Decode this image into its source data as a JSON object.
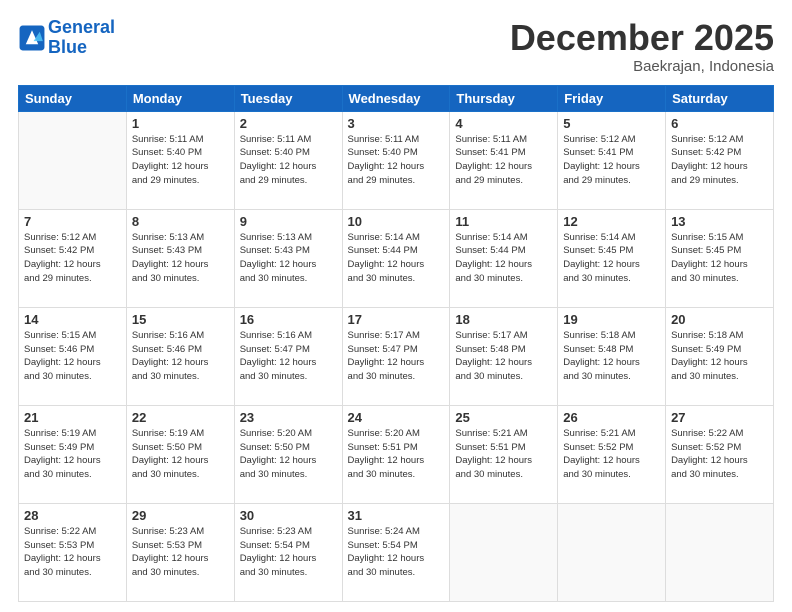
{
  "header": {
    "logo_line1": "General",
    "logo_line2": "Blue",
    "month": "December 2025",
    "location": "Baekrajan, Indonesia"
  },
  "weekdays": [
    "Sunday",
    "Monday",
    "Tuesday",
    "Wednesday",
    "Thursday",
    "Friday",
    "Saturday"
  ],
  "rows": [
    [
      {
        "day": "",
        "info": ""
      },
      {
        "day": "1",
        "info": "Sunrise: 5:11 AM\nSunset: 5:40 PM\nDaylight: 12 hours\nand 29 minutes."
      },
      {
        "day": "2",
        "info": "Sunrise: 5:11 AM\nSunset: 5:40 PM\nDaylight: 12 hours\nand 29 minutes."
      },
      {
        "day": "3",
        "info": "Sunrise: 5:11 AM\nSunset: 5:40 PM\nDaylight: 12 hours\nand 29 minutes."
      },
      {
        "day": "4",
        "info": "Sunrise: 5:11 AM\nSunset: 5:41 PM\nDaylight: 12 hours\nand 29 minutes."
      },
      {
        "day": "5",
        "info": "Sunrise: 5:12 AM\nSunset: 5:41 PM\nDaylight: 12 hours\nand 29 minutes."
      },
      {
        "day": "6",
        "info": "Sunrise: 5:12 AM\nSunset: 5:42 PM\nDaylight: 12 hours\nand 29 minutes."
      }
    ],
    [
      {
        "day": "7",
        "info": "Sunrise: 5:12 AM\nSunset: 5:42 PM\nDaylight: 12 hours\nand 29 minutes."
      },
      {
        "day": "8",
        "info": "Sunrise: 5:13 AM\nSunset: 5:43 PM\nDaylight: 12 hours\nand 30 minutes."
      },
      {
        "day": "9",
        "info": "Sunrise: 5:13 AM\nSunset: 5:43 PM\nDaylight: 12 hours\nand 30 minutes."
      },
      {
        "day": "10",
        "info": "Sunrise: 5:14 AM\nSunset: 5:44 PM\nDaylight: 12 hours\nand 30 minutes."
      },
      {
        "day": "11",
        "info": "Sunrise: 5:14 AM\nSunset: 5:44 PM\nDaylight: 12 hours\nand 30 minutes."
      },
      {
        "day": "12",
        "info": "Sunrise: 5:14 AM\nSunset: 5:45 PM\nDaylight: 12 hours\nand 30 minutes."
      },
      {
        "day": "13",
        "info": "Sunrise: 5:15 AM\nSunset: 5:45 PM\nDaylight: 12 hours\nand 30 minutes."
      }
    ],
    [
      {
        "day": "14",
        "info": "Sunrise: 5:15 AM\nSunset: 5:46 PM\nDaylight: 12 hours\nand 30 minutes."
      },
      {
        "day": "15",
        "info": "Sunrise: 5:16 AM\nSunset: 5:46 PM\nDaylight: 12 hours\nand 30 minutes."
      },
      {
        "day": "16",
        "info": "Sunrise: 5:16 AM\nSunset: 5:47 PM\nDaylight: 12 hours\nand 30 minutes."
      },
      {
        "day": "17",
        "info": "Sunrise: 5:17 AM\nSunset: 5:47 PM\nDaylight: 12 hours\nand 30 minutes."
      },
      {
        "day": "18",
        "info": "Sunrise: 5:17 AM\nSunset: 5:48 PM\nDaylight: 12 hours\nand 30 minutes."
      },
      {
        "day": "19",
        "info": "Sunrise: 5:18 AM\nSunset: 5:48 PM\nDaylight: 12 hours\nand 30 minutes."
      },
      {
        "day": "20",
        "info": "Sunrise: 5:18 AM\nSunset: 5:49 PM\nDaylight: 12 hours\nand 30 minutes."
      }
    ],
    [
      {
        "day": "21",
        "info": "Sunrise: 5:19 AM\nSunset: 5:49 PM\nDaylight: 12 hours\nand 30 minutes."
      },
      {
        "day": "22",
        "info": "Sunrise: 5:19 AM\nSunset: 5:50 PM\nDaylight: 12 hours\nand 30 minutes."
      },
      {
        "day": "23",
        "info": "Sunrise: 5:20 AM\nSunset: 5:50 PM\nDaylight: 12 hours\nand 30 minutes."
      },
      {
        "day": "24",
        "info": "Sunrise: 5:20 AM\nSunset: 5:51 PM\nDaylight: 12 hours\nand 30 minutes."
      },
      {
        "day": "25",
        "info": "Sunrise: 5:21 AM\nSunset: 5:51 PM\nDaylight: 12 hours\nand 30 minutes."
      },
      {
        "day": "26",
        "info": "Sunrise: 5:21 AM\nSunset: 5:52 PM\nDaylight: 12 hours\nand 30 minutes."
      },
      {
        "day": "27",
        "info": "Sunrise: 5:22 AM\nSunset: 5:52 PM\nDaylight: 12 hours\nand 30 minutes."
      }
    ],
    [
      {
        "day": "28",
        "info": "Sunrise: 5:22 AM\nSunset: 5:53 PM\nDaylight: 12 hours\nand 30 minutes."
      },
      {
        "day": "29",
        "info": "Sunrise: 5:23 AM\nSunset: 5:53 PM\nDaylight: 12 hours\nand 30 minutes."
      },
      {
        "day": "30",
        "info": "Sunrise: 5:23 AM\nSunset: 5:54 PM\nDaylight: 12 hours\nand 30 minutes."
      },
      {
        "day": "31",
        "info": "Sunrise: 5:24 AM\nSunset: 5:54 PM\nDaylight: 12 hours\nand 30 minutes."
      },
      {
        "day": "",
        "info": ""
      },
      {
        "day": "",
        "info": ""
      },
      {
        "day": "",
        "info": ""
      }
    ]
  ]
}
